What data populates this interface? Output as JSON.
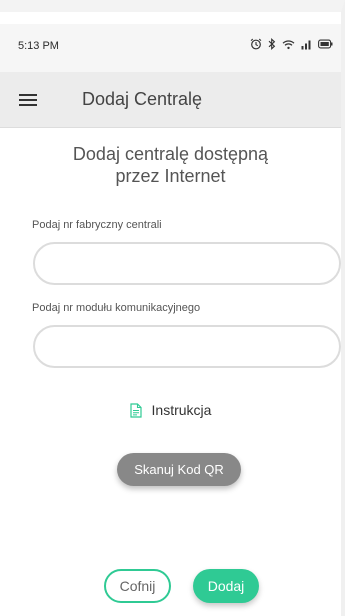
{
  "status_bar": {
    "time": "5:13 PM",
    "icons": [
      "alarm-icon",
      "bluetooth-icon",
      "wifi-icon",
      "signal-icon",
      "battery-icon"
    ]
  },
  "app_bar": {
    "menu_icon": "hamburger-menu-icon",
    "title": "Dodaj Centralę"
  },
  "main": {
    "heading_line1": "Dodaj centralę dostępną",
    "heading_line2": "przez Internet",
    "serial_field": {
      "label": "Podaj nr fabryczny centrali",
      "value": "",
      "placeholder": ""
    },
    "module_field": {
      "label": "Podaj nr modułu komunikacyjnego",
      "value": "",
      "placeholder": ""
    },
    "instructions": {
      "icon": "document-icon",
      "label": "Instrukcja"
    },
    "scan_qr_label": "Skanuj Kod QR"
  },
  "footer": {
    "back_label": "Cofnij",
    "add_label": "Dodaj"
  },
  "colors": {
    "accent": "#2fca94",
    "secondary_button": "#888888",
    "app_bar_bg": "#ececec"
  }
}
